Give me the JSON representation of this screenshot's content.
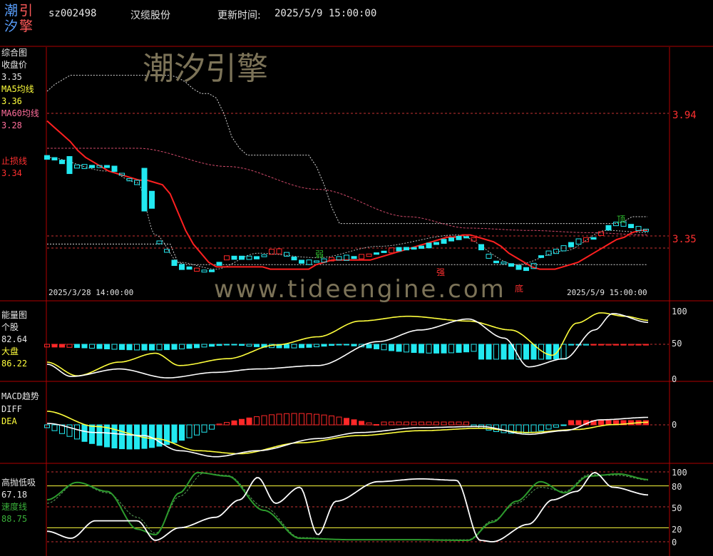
{
  "header": {
    "logo_chars": [
      "潮",
      "引",
      "汐",
      "擎"
    ],
    "code": "sz002498",
    "name": "汉缆股份",
    "update_label": "更新时间:",
    "update_time": "2025/5/9 15:00:00"
  },
  "watermark": {
    "title": "潮汐引擎",
    "url": "www.tideengine.com"
  },
  "colors": {
    "background": "#000000",
    "frame": "#b00000",
    "gridline": "#c83232",
    "price_white": "#ffffff",
    "ma5_yellow": "#ffff3c",
    "ma60_pink": "#d04a6a",
    "stop_red": "#ff2020",
    "up_red": "#ff2828",
    "down_cyan": "#22e8f0",
    "speed_green": "#2d9b2d",
    "label_pink": "#ff6e9b"
  },
  "panel_main": {
    "title": "综合图",
    "close_label": "收盘价",
    "close_value": "3.35",
    "ma5_label": "MA5均线",
    "ma5_value": "3.36",
    "ma60_label": "MA60均线",
    "ma60_value": "3.28",
    "stop_label": "止损线",
    "stop_value": "3.34",
    "price_ticks": [
      "3.94",
      "3.35"
    ],
    "date_start": "2025/3/28 14:00:00",
    "date_end": "2025/5/9 15:00:00",
    "markers": [
      "顶",
      "弱",
      "强",
      "底"
    ]
  },
  "panel_energy": {
    "title": "能量图",
    "stock_label": "个股",
    "stock_value": "82.64",
    "market_label": "大盘",
    "market_value": "86.22",
    "ticks": [
      "100",
      "50",
      "0"
    ]
  },
  "panel_macd": {
    "title": "MACD趋势",
    "diff_label": "DIFF",
    "dea_label": "DEA",
    "ticks": [
      "0"
    ]
  },
  "panel_osc": {
    "title": "高抛低吸",
    "value": "67.18",
    "speed_label": "速度线",
    "speed_value": "88.75",
    "ticks": [
      "100",
      "80",
      "50",
      "20",
      "0"
    ]
  },
  "chart_data": [
    {
      "type": "line",
      "title": "综合图",
      "x_range": [
        "2025/3/28 14:00:00",
        "2025/5/9 15:00:00"
      ],
      "y_ticks": [
        3.94,
        3.35
      ],
      "series": [
        {
          "name": "收盘价",
          "last": 3.35
        },
        {
          "name": "MA5均线",
          "last": 3.36
        },
        {
          "name": "MA60均线",
          "last": 3.28
        },
        {
          "name": "止损线",
          "last": 3.34
        }
      ],
      "stop_line": [
        3.82,
        3.79,
        3.76,
        3.73,
        3.69,
        3.66,
        3.64,
        3.62,
        3.6,
        3.59,
        3.58,
        3.57,
        3.56,
        3.56,
        3.55,
        3.54,
        3.5,
        3.42,
        3.34,
        3.28,
        3.24,
        3.2,
        3.18,
        3.18,
        3.18,
        3.18,
        3.18,
        3.18,
        3.18,
        3.17,
        3.17,
        3.17,
        3.17,
        3.17,
        3.17,
        3.19,
        3.2,
        3.21,
        3.21,
        3.21,
        3.21,
        3.21,
        3.21,
        3.22,
        3.23,
        3.24,
        3.25,
        3.26,
        3.27,
        3.28,
        3.29,
        3.3,
        3.31,
        3.31,
        3.32,
        3.32,
        3.31,
        3.3,
        3.29,
        3.27,
        3.24,
        3.22,
        3.2,
        3.18,
        3.17,
        3.17,
        3.17,
        3.18,
        3.19,
        3.2,
        3.22,
        3.24,
        3.26,
        3.28,
        3.3,
        3.31,
        3.33,
        3.34,
        3.34
      ],
      "upper_band": [
        3.95,
        3.98,
        4.0,
        4.02,
        4.02,
        4.02,
        4.02,
        4.02,
        4.02,
        4.02,
        4.02,
        4.02,
        4.02,
        4.02,
        4.02,
        4.02,
        4.02,
        4.01,
        3.99,
        3.96,
        3.94,
        3.94,
        3.92,
        3.85,
        3.75,
        3.7,
        3.67,
        3.67,
        3.67,
        3.67,
        3.67,
        3.67,
        3.67,
        3.67,
        3.67,
        3.62,
        3.54,
        3.44,
        3.37,
        3.37,
        3.37,
        3.37,
        3.37,
        3.37,
        3.37,
        3.37,
        3.37,
        3.37,
        3.37,
        3.37,
        3.37,
        3.37,
        3.37,
        3.37,
        3.37,
        3.37,
        3.37,
        3.37,
        3.37,
        3.37,
        3.37,
        3.37,
        3.37,
        3.37,
        3.37,
        3.37,
        3.37,
        3.37,
        3.37,
        3.37,
        3.37,
        3.37,
        3.37,
        3.37,
        3.37,
        3.38,
        3.4,
        3.4,
        3.4
      ],
      "lower_band": [
        3.28,
        3.28,
        3.28,
        3.28,
        3.28,
        3.28,
        3.28,
        3.28,
        3.28,
        3.28,
        3.28,
        3.28,
        3.28,
        3.28,
        3.28,
        3.28,
        3.28,
        3.2,
        3.19,
        3.19,
        3.19,
        3.19,
        3.19,
        3.19,
        3.19,
        3.19,
        3.19,
        3.19,
        3.19,
        3.19,
        3.19,
        3.19,
        3.19,
        3.19,
        3.19,
        3.19,
        3.19,
        3.19,
        3.19,
        3.19,
        3.19,
        3.19,
        3.19,
        3.19,
        3.19,
        3.19,
        3.19,
        3.19,
        3.19,
        3.19,
        3.19,
        3.19,
        3.19,
        3.19,
        3.19,
        3.19,
        3.19,
        3.19,
        3.19,
        3.19,
        3.19,
        3.19,
        3.19,
        3.19,
        3.19,
        3.19,
        3.19,
        3.19,
        3.19,
        3.19,
        3.19,
        3.19,
        3.19,
        3.19,
        3.19,
        3.19,
        3.19,
        3.19,
        3.19
      ]
    },
    {
      "type": "line",
      "title": "能量图",
      "y_range": [
        0,
        100
      ],
      "series": [
        {
          "name": "个股",
          "last": 82.64
        },
        {
          "name": "大盘",
          "last": 86.22
        }
      ]
    },
    {
      "type": "line",
      "title": "MACD趋势",
      "series": [
        {
          "name": "DIFF"
        },
        {
          "name": "DEA"
        }
      ]
    },
    {
      "type": "line",
      "title": "高抛低吸",
      "y_range": [
        0,
        100
      ],
      "series": [
        {
          "name": "高抛低吸",
          "last": 67.18
        },
        {
          "name": "速度线",
          "last": 88.75
        }
      ]
    }
  ]
}
